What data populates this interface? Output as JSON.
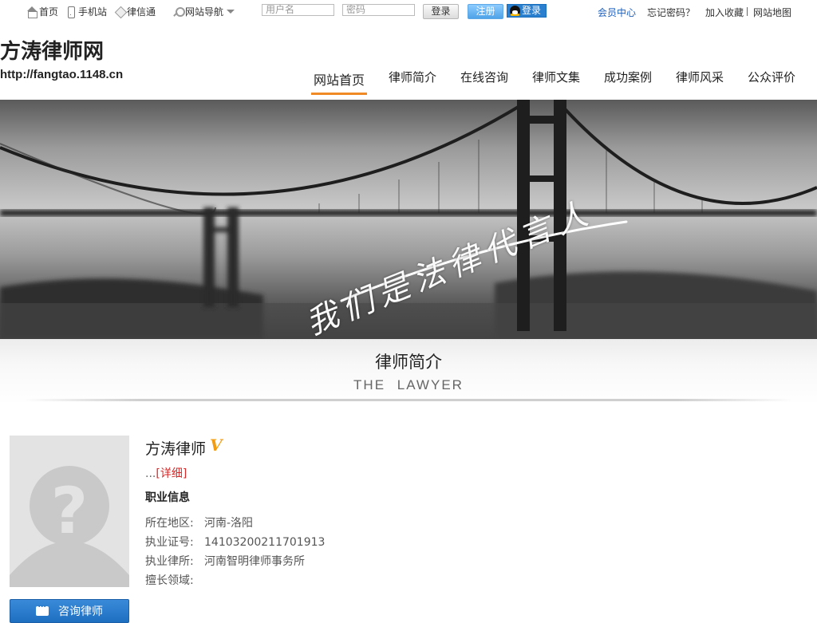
{
  "topbar": {
    "links": [
      {
        "icon": "home-icon",
        "label": "首页"
      },
      {
        "icon": "mobile-icon",
        "label": "手机站"
      },
      {
        "icon": "diamond-icon",
        "label": "律信通"
      },
      {
        "icon": "search-icon",
        "label": "网站导航"
      }
    ],
    "username_placeholder": "用户名",
    "password_placeholder": "密码",
    "login_label": "登录",
    "register_label": "注册",
    "qq_login_label": "登录",
    "member_center": "会员中心",
    "forgot_password": "忘记密码？",
    "add_favorite": "加入收藏",
    "sitemap": "网站地图"
  },
  "header": {
    "site_title": "方涛律师网",
    "site_url": "http://fangtao.1148.cn"
  },
  "nav": {
    "items": [
      "网站首页",
      "律师简介",
      "在线咨询",
      "律师文集",
      "成功案例",
      "律师风采",
      "公众评价"
    ],
    "active_index": 0,
    "accent_color": "#f08a24"
  },
  "banner": {
    "slogan": "我们是法律代言人"
  },
  "section": {
    "title_cn": "律师简介",
    "title_en": "THE   LAWYER"
  },
  "profile": {
    "name": "方涛律师",
    "verified_badge": "V",
    "intro_ellipsis": "...",
    "detail_link": "[详细]",
    "info_title": "职业信息",
    "rows": [
      {
        "label": "所在地区:",
        "value": "河南-洛阳"
      },
      {
        "label": "执业证号:",
        "value": "14103200211701913"
      },
      {
        "label": "执业律所:",
        "value": "河南智明律师事务所"
      },
      {
        "label": "擅长领域:",
        "value": ""
      }
    ],
    "consult_button": "咨询律师"
  }
}
